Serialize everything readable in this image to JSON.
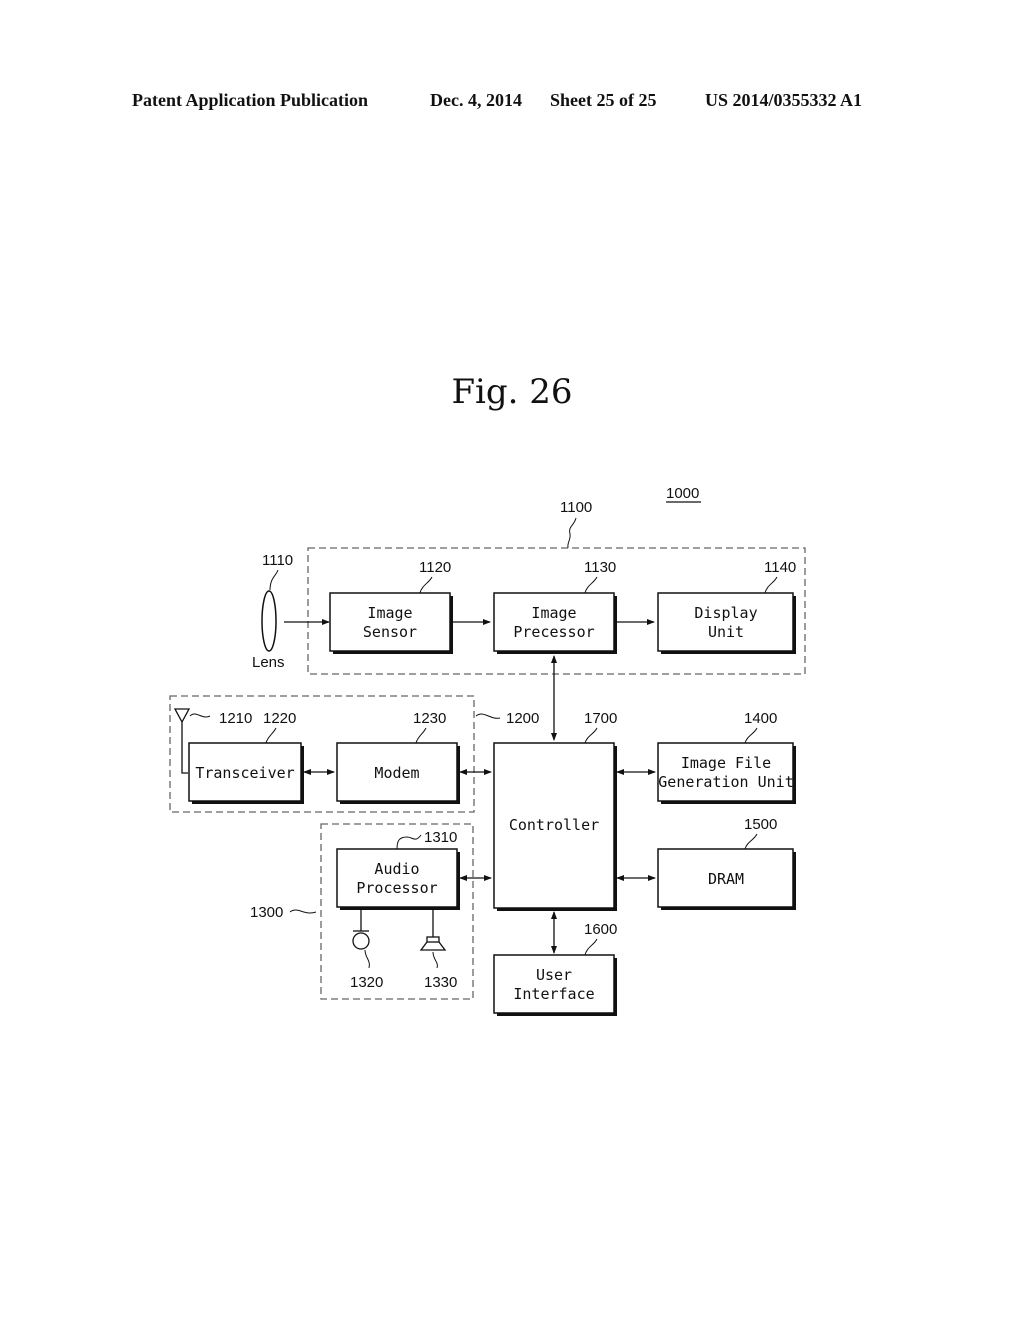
{
  "header": {
    "publication": "Patent Application Publication",
    "date": "Dec. 4, 2014",
    "sheet": "Sheet 25 of 25",
    "patent_number": "US 2014/0355332 A1"
  },
  "figure": {
    "title": "Fig. 26",
    "system_ref": "1000"
  },
  "groups": {
    "camera": {
      "ref": "1100"
    },
    "rf": {
      "ref": "1200"
    },
    "audio": {
      "ref": "1300"
    }
  },
  "components": {
    "lens": {
      "ref": "1110",
      "label": "Lens"
    },
    "image_sensor": {
      "ref": "1120",
      "line1": "Image",
      "line2": "Sensor"
    },
    "image_processor": {
      "ref": "1130",
      "line1": "Image",
      "line2": "Precessor"
    },
    "display_unit": {
      "ref": "1140",
      "line1": "Display",
      "line2": "Unit"
    },
    "antenna": {
      "ref": "1210"
    },
    "transceiver": {
      "ref": "1220",
      "label": "Transceiver"
    },
    "modem": {
      "ref": "1230",
      "label": "Modem"
    },
    "audio_processor": {
      "ref": "1310",
      "line1": "Audio",
      "line2": "Processor"
    },
    "microphone": {
      "ref": "1320"
    },
    "speaker": {
      "ref": "1330"
    },
    "image_file_gen": {
      "ref": "1400",
      "line1": "Image File",
      "line2": "Generation Unit"
    },
    "dram": {
      "ref": "1500",
      "label": "DRAM"
    },
    "user_interface": {
      "ref": "1600",
      "line1": "User",
      "line2": "Interface"
    },
    "controller": {
      "ref": "1700",
      "label": "Controller"
    }
  }
}
